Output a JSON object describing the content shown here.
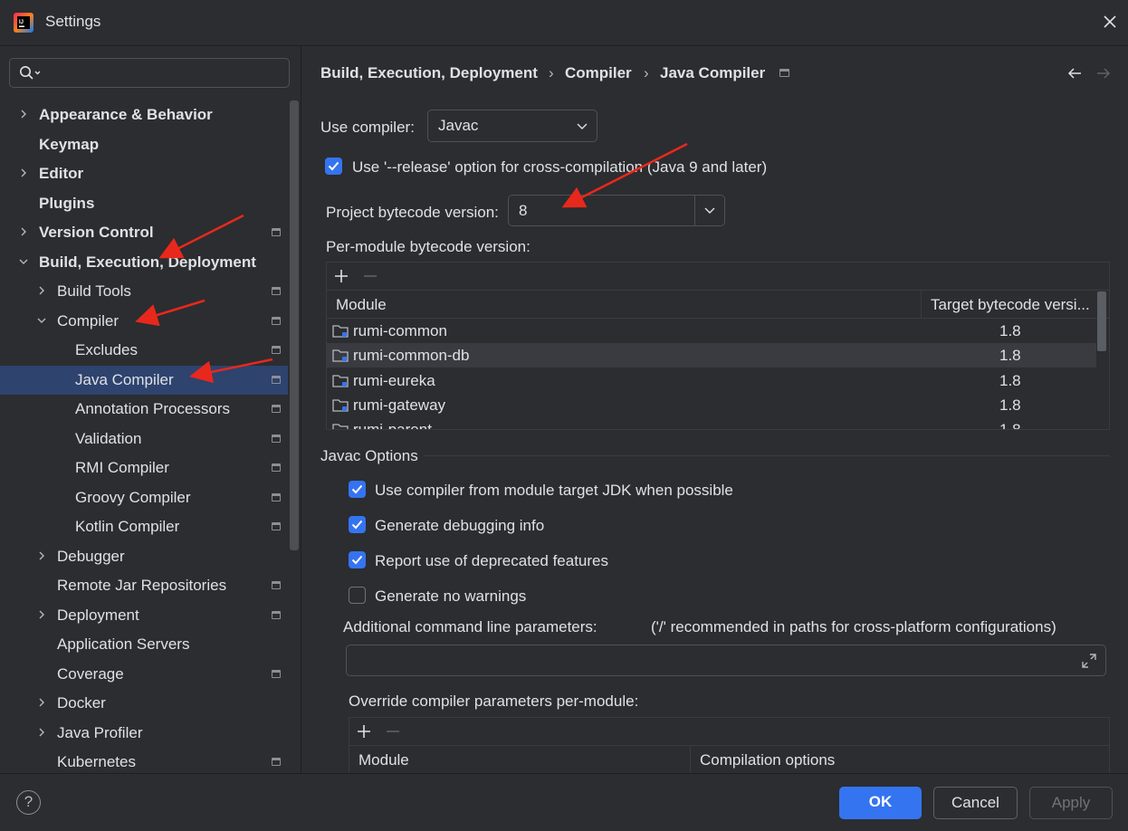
{
  "window": {
    "title": "Settings",
    "app_icon": "intellij-logo-icon",
    "close_icon": "close-icon"
  },
  "search": {
    "placeholder": "",
    "icon": "search-icon"
  },
  "tree": {
    "items": [
      {
        "label": "Appearance & Behavior",
        "level": 0,
        "bold": true,
        "expandable": true,
        "expanded": false,
        "pinned": false,
        "selected": false
      },
      {
        "label": "Keymap",
        "level": 0,
        "bold": true,
        "expandable": false,
        "pinned": false,
        "selected": false
      },
      {
        "label": "Editor",
        "level": 0,
        "bold": true,
        "expandable": true,
        "expanded": false,
        "pinned": false,
        "selected": false
      },
      {
        "label": "Plugins",
        "level": 0,
        "bold": true,
        "expandable": false,
        "pinned": false,
        "selected": false
      },
      {
        "label": "Version Control",
        "level": 0,
        "bold": true,
        "expandable": true,
        "expanded": false,
        "pinned": true,
        "selected": false
      },
      {
        "label": "Build, Execution, Deployment",
        "level": 0,
        "bold": true,
        "expandable": true,
        "expanded": true,
        "pinned": false,
        "selected": false
      },
      {
        "label": "Build Tools",
        "level": 1,
        "bold": false,
        "expandable": true,
        "expanded": false,
        "pinned": true,
        "selected": false
      },
      {
        "label": "Compiler",
        "level": 1,
        "bold": false,
        "expandable": true,
        "expanded": true,
        "pinned": true,
        "selected": false
      },
      {
        "label": "Excludes",
        "level": 2,
        "bold": false,
        "expandable": false,
        "pinned": true,
        "selected": false
      },
      {
        "label": "Java Compiler",
        "level": 2,
        "bold": false,
        "expandable": false,
        "pinned": true,
        "selected": true
      },
      {
        "label": "Annotation Processors",
        "level": 2,
        "bold": false,
        "expandable": false,
        "pinned": true,
        "selected": false
      },
      {
        "label": "Validation",
        "level": 2,
        "bold": false,
        "expandable": false,
        "pinned": true,
        "selected": false
      },
      {
        "label": "RMI Compiler",
        "level": 2,
        "bold": false,
        "expandable": false,
        "pinned": true,
        "selected": false
      },
      {
        "label": "Groovy Compiler",
        "level": 2,
        "bold": false,
        "expandable": false,
        "pinned": true,
        "selected": false
      },
      {
        "label": "Kotlin Compiler",
        "level": 2,
        "bold": false,
        "expandable": false,
        "pinned": true,
        "selected": false
      },
      {
        "label": "Debugger",
        "level": 1,
        "bold": false,
        "expandable": true,
        "expanded": false,
        "pinned": false,
        "selected": false
      },
      {
        "label": "Remote Jar Repositories",
        "level": 1,
        "bold": false,
        "expandable": false,
        "pinned": true,
        "selected": false
      },
      {
        "label": "Deployment",
        "level": 1,
        "bold": false,
        "expandable": true,
        "expanded": false,
        "pinned": true,
        "selected": false
      },
      {
        "label": "Application Servers",
        "level": 1,
        "bold": false,
        "expandable": false,
        "pinned": false,
        "selected": false
      },
      {
        "label": "Coverage",
        "level": 1,
        "bold": false,
        "expandable": false,
        "pinned": true,
        "selected": false
      },
      {
        "label": "Docker",
        "level": 1,
        "bold": false,
        "expandable": true,
        "expanded": false,
        "pinned": false,
        "selected": false
      },
      {
        "label": "Java Profiler",
        "level": 1,
        "bold": false,
        "expandable": true,
        "expanded": false,
        "pinned": false,
        "selected": false
      },
      {
        "label": "Kubernetes",
        "level": 1,
        "bold": false,
        "expandable": false,
        "pinned": true,
        "selected": false
      }
    ]
  },
  "breadcrumb": {
    "items": [
      "Build, Execution, Deployment",
      "Compiler",
      "Java Compiler"
    ],
    "separator": "›"
  },
  "nav": {
    "back_icon": "arrow-left-icon",
    "forward_icon": "arrow-right-icon"
  },
  "compiler": {
    "use_compiler_label": "Use compiler:",
    "use_compiler_value": "Javac",
    "release_option_label": "Use '--release' option for cross-compilation (Java 9 and later)",
    "release_option_checked": true,
    "project_bytecode_label": "Project bytecode version:",
    "project_bytecode_value": "8",
    "per_module_label": "Per-module bytecode version:"
  },
  "module_table": {
    "columns": [
      "Module",
      "Target bytecode versi..."
    ],
    "rows": [
      {
        "module": "rumi-common",
        "version": "1.8"
      },
      {
        "module": "rumi-common-db",
        "version": "1.8"
      },
      {
        "module": "rumi-eureka",
        "version": "1.8"
      },
      {
        "module": "rumi-gateway",
        "version": "1.8"
      },
      {
        "module": "rumi-parent",
        "version": "1.8"
      }
    ]
  },
  "javac": {
    "section_title": "Javac Options",
    "options": [
      {
        "label": "Use compiler from module target JDK when possible",
        "checked": true
      },
      {
        "label": "Generate debugging info",
        "checked": true
      },
      {
        "label": "Report use of deprecated features",
        "checked": true
      },
      {
        "label": "Generate no warnings",
        "checked": false
      }
    ],
    "additional_params_label": "Additional command line parameters:",
    "additional_params_hint": "('/' recommended in paths for cross-platform configurations)",
    "additional_params_value": "",
    "override_label": "Override compiler parameters per-module:",
    "override_columns": [
      "Module",
      "Compilation options"
    ]
  },
  "footer": {
    "help": "?",
    "ok": "OK",
    "cancel": "Cancel",
    "apply": "Apply"
  },
  "colors": {
    "accent": "#3574f0",
    "selection": "#2e436e",
    "annotation": "#e8281c"
  }
}
